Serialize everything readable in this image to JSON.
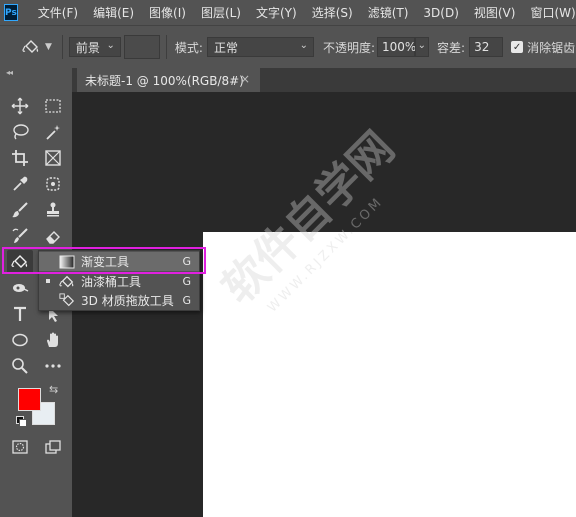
{
  "app": {
    "logo_text": "Ps"
  },
  "menubar": {
    "items": [
      {
        "label": "文件(F)"
      },
      {
        "label": "编辑(E)"
      },
      {
        "label": "图像(I)"
      },
      {
        "label": "图层(L)"
      },
      {
        "label": "文字(Y)"
      },
      {
        "label": "选择(S)"
      },
      {
        "label": "滤镜(T)"
      },
      {
        "label": "3D(D)"
      },
      {
        "label": "视图(V)"
      },
      {
        "label": "窗口(W)"
      }
    ]
  },
  "options": {
    "fill_source": "前景",
    "mode_label": "模式:",
    "mode_value": "正常",
    "opacity_label": "不透明度:",
    "opacity_value": "100%",
    "tolerance_label": "容差:",
    "tolerance_value": "32",
    "antialias_label": "消除锯齿",
    "antialias_checked": true
  },
  "document": {
    "tab_title": "未标题-1 @ 100%(RGB/8#)",
    "close_glyph": "×"
  },
  "flyout": {
    "items": [
      {
        "label": "渐变工具",
        "shortcut": "G",
        "selected": true,
        "icon": "gradient-icon"
      },
      {
        "label": "油漆桶工具",
        "shortcut": "G",
        "selected": false,
        "icon": "paint-bucket-icon"
      },
      {
        "label": "3D 材质拖放工具",
        "shortcut": "G",
        "selected": false,
        "icon": "3d-material-drop-icon"
      }
    ]
  },
  "toolbar": {
    "collapse_glyph": "◂◂",
    "foreground_color": "#ff0000",
    "background_color": "#e8eef2"
  },
  "watermark": {
    "text": "软件自学网",
    "sub": "WWW.RJZXW.COM"
  },
  "colors": {
    "highlight": "#e020e0",
    "accent": "#31a8ff"
  }
}
